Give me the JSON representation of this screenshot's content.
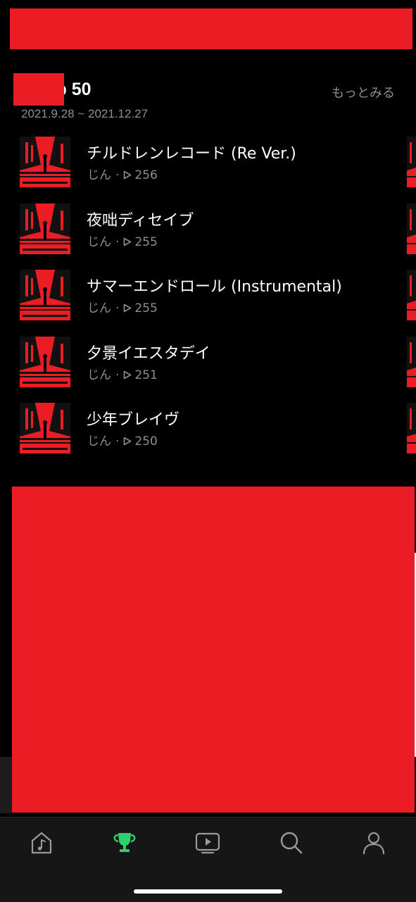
{
  "section": {
    "title": "s Top 50",
    "more_label": "もっとみる",
    "date_range": "2021.9.28 ~ 2021.12.27"
  },
  "tracks": [
    {
      "title": "チルドレンレコード (Re Ver.)",
      "artist": "じん",
      "plays": "256"
    },
    {
      "title": "夜咄ディセイブ",
      "artist": "じん",
      "plays": "255"
    },
    {
      "title": "サマーエンドロール (Instrumental)",
      "artist": "じん",
      "plays": "255"
    },
    {
      "title": "夕景イエスタデイ",
      "artist": "じん",
      "plays": "251"
    },
    {
      "title": "少年ブレイヴ",
      "artist": "じん",
      "plays": "250"
    }
  ],
  "tabbar": {
    "items": [
      {
        "icon": "music-library-icon",
        "active": false
      },
      {
        "icon": "trophy-icon",
        "active": true
      },
      {
        "icon": "video-icon",
        "active": false
      },
      {
        "icon": "search-icon",
        "active": false
      },
      {
        "icon": "profile-icon",
        "active": false
      }
    ]
  },
  "colors": {
    "background": "#000000",
    "redaction": "#ec1c24",
    "active_tab": "#2bd16a",
    "inactive_tab": "#9a9a9a",
    "secondary_text": "#8e8e93"
  }
}
